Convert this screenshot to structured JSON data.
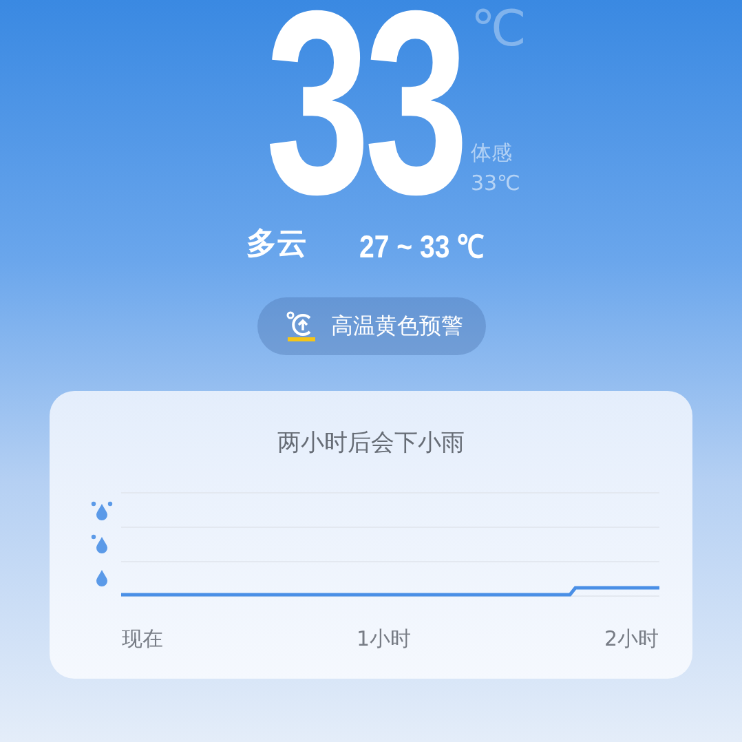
{
  "current": {
    "temperature": "33",
    "unit": "℃",
    "feels_like_label": "体感",
    "feels_like": "33℃"
  },
  "condition": "多云",
  "range": "27 ~ 33 ℃",
  "alert": {
    "text": "高温黄色预警"
  },
  "rain_card": {
    "title": "两小时后会下小雨",
    "x_labels": [
      "现在",
      "1小时",
      "2小时"
    ]
  }
}
